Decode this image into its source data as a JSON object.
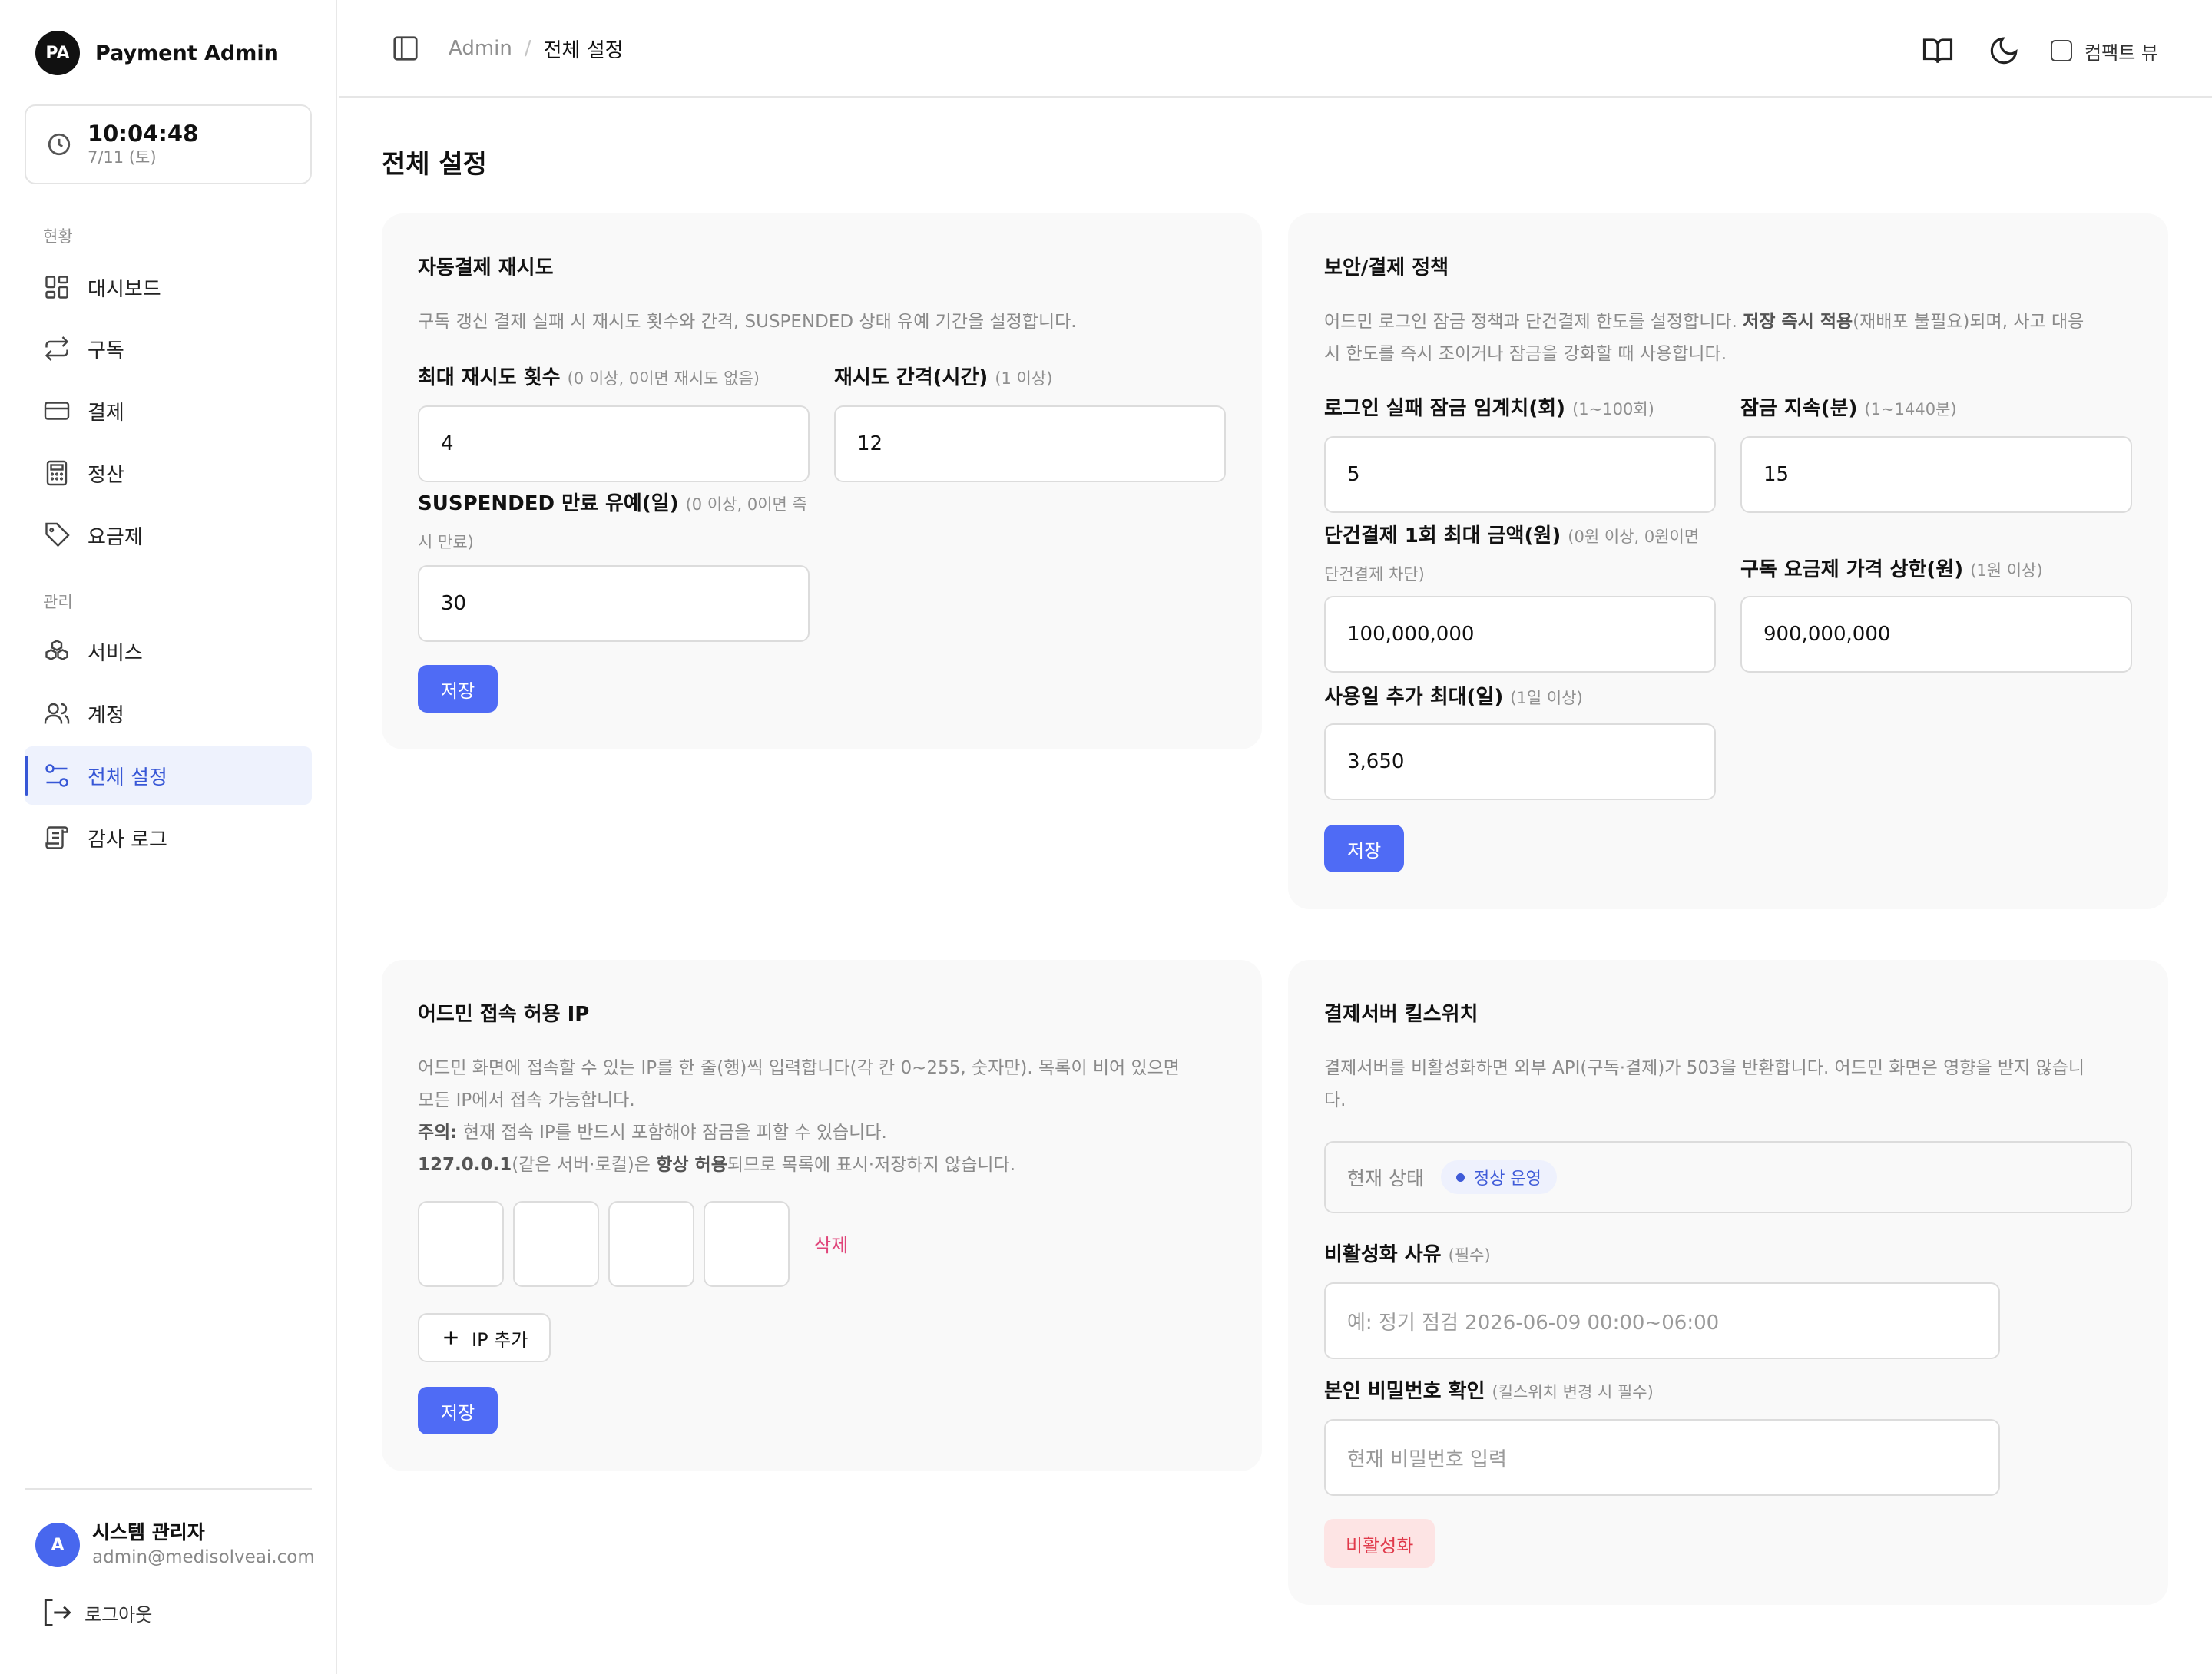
{
  "brand": {
    "logo": "PA",
    "name": "Payment Admin"
  },
  "clock": {
    "time": "10:04:48",
    "date": "7/11 (토)"
  },
  "nav": {
    "section_status": "현황",
    "section_manage": "관리",
    "items": [
      {
        "label": "대시보드",
        "icon": "dashboard-icon"
      },
      {
        "label": "구독",
        "icon": "repeat-icon"
      },
      {
        "label": "결제",
        "icon": "credit-card-icon"
      },
      {
        "label": "정산",
        "icon": "calculator-icon"
      },
      {
        "label": "요금제",
        "icon": "tag-icon"
      },
      {
        "label": "서비스",
        "icon": "boxes-icon"
      },
      {
        "label": "계정",
        "icon": "users-icon"
      },
      {
        "label": "전체 설정",
        "icon": "settings-sliders-icon",
        "active": true
      },
      {
        "label": "감사 로그",
        "icon": "scroll-icon"
      }
    ]
  },
  "user": {
    "avatar": "A",
    "name": "시스템 관리자",
    "email": "admin@medisolveai.com"
  },
  "logout_label": "로그아웃",
  "topbar": {
    "breadcrumb_root": "Admin",
    "breadcrumb_sep": "/",
    "breadcrumb_current": "전체 설정",
    "compact_view_label": "컴팩트 뷰"
  },
  "page_title": "전체 설정",
  "retry_card": {
    "title": "자동결제 재시도",
    "desc": "구독 갱신 결제 실패 시 재시도 횟수와 간격, SUSPENDED 상태 유예 기간을 설정합니다.",
    "max_retry_label": "최대 재시도 횟수",
    "max_retry_hint": "(0 이상, 0이면 재시도 없음)",
    "max_retry_value": "4",
    "interval_label": "재시도 간격(시간)",
    "interval_hint": "(1 이상)",
    "interval_value": "12",
    "grace_label": "SUSPENDED 만료 유예(일)",
    "grace_hint_1": "(0 이상, 0이면 즉",
    "grace_hint_2": "시 만료)",
    "grace_value": "30",
    "save_label": "저장"
  },
  "security_card": {
    "title": "보안/결제 정책",
    "desc_1": "어드민 로그인 잠금 정책과 단건결제 한도를 설정합니다.",
    "desc_bold": "저장 즉시 적용",
    "desc_2": "(재배포 불필요)되며, 사고 대응",
    "desc_3": "시 한도를 즉시 조이거나 잠금을 강화할 때 사용합니다.",
    "lock_threshold_label": "로그인 실패 잠금 임계치(회)",
    "lock_threshold_hint": "(1~100회)",
    "lock_threshold_value": "5",
    "lock_duration_label": "잠금 지속(분)",
    "lock_duration_hint": "(1~1440분)",
    "lock_duration_value": "15",
    "single_max_label": "단건결제 1회 최대 금액(원)",
    "single_max_hint_1": "(0원 이상, 0원이면",
    "single_max_hint_2": "단건결제 차단)",
    "single_max_value": "100,000,000",
    "plan_cap_label": "구독 요금제 가격 상한(원)",
    "plan_cap_hint": "(1원 이상)",
    "plan_cap_value": "900,000,000",
    "extra_days_label": "사용일 추가 최대(일)",
    "extra_days_hint": "(1일 이상)",
    "extra_days_value": "3,650",
    "save_label": "저장"
  },
  "ip_card": {
    "title": "어드민 접속 허용 IP",
    "desc_1": "어드민 화면에 접속할 수 있는 IP를 한 줄(행)씩 입력합니다(각 칸 0~255, 숫자만). 목록이 비어 있으면",
    "desc_2": "모든 IP에서 접속 가능합니다.",
    "note_bold": "주의:",
    "note_text": " 현재 접속 IP를 반드시 포함해야 잠금을 피할 수 있습니다.",
    "local_bold": "127.0.0.1",
    "local_text_1": "(같은 서버·로컬)은 ",
    "local_bold_2": "항상 허용",
    "local_text_2": "되므로 목록에 표시·저장하지 않습니다.",
    "delete_label": "삭제",
    "add_label": "IP 추가",
    "save_label": "저장"
  },
  "kill_card": {
    "title": "결제서버 킬스위치",
    "desc_1": "결제서버를 비활성화하면 외부 API(구독·결제)가 503을 반환합니다. 어드민 화면은 영향을 받지 않습니",
    "desc_2": "다.",
    "status_label": "현재 상태",
    "status_value": "정상 운영",
    "reason_label": "비활성화 사유",
    "reason_hint": "(필수)",
    "reason_placeholder": "예: 정기 점검 2026-06-09 00:00~06:00",
    "password_label": "본인 비밀번호 확인",
    "password_hint": "(킬스위치 변경 시 필수)",
    "password_placeholder": "현재 비밀번호 입력",
    "disable_label": "비활성화"
  },
  "colors": {
    "accent": "#4f6bf5",
    "active_nav_bg": "#eef2fd",
    "danger_text": "#e0394a",
    "danger_bg": "#fde4e4",
    "delete_link": "#e0457a",
    "card_bg": "#f9f9f9"
  }
}
